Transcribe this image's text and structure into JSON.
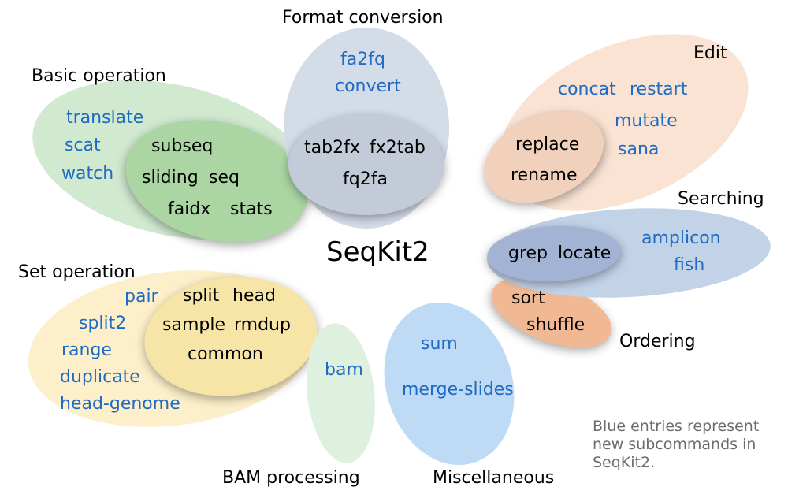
{
  "title": "SeqKit2",
  "caption": {
    "line1": "Blue entries represent",
    "line2": "new subcommands in",
    "line3": "SeqKit2."
  },
  "groups": {
    "basic": {
      "label": "Basic operation",
      "new": {
        "translate": "translate",
        "scat": "scat",
        "watch": "watch"
      },
      "old": {
        "subseq": "subseq",
        "sliding": "sliding",
        "seq": "seq",
        "faidx": "faidx",
        "stats": "stats"
      }
    },
    "set": {
      "label": "Set operation",
      "new": {
        "pair": "pair",
        "split2": "split2",
        "range": "range",
        "duplicate": "duplicate",
        "headgenome": "head-genome"
      },
      "old": {
        "split": "split",
        "head": "head",
        "sample": "sample",
        "rmdup": "rmdup",
        "common": "common"
      }
    },
    "format": {
      "label": "Format conversion",
      "new": {
        "fa2fq": "fa2fq",
        "convert": "convert"
      },
      "old": {
        "tab2fx": "tab2fx",
        "fx2tab": "fx2tab",
        "fq2fa": "fq2fa"
      }
    },
    "bam": {
      "label": "BAM processing",
      "new": {
        "bam": "bam"
      }
    },
    "misc": {
      "label": "Miscellaneous",
      "new": {
        "sum": "sum",
        "mergeslides": "merge-slides"
      }
    },
    "edit": {
      "label": "Edit",
      "new": {
        "concat": "concat",
        "restart": "restart",
        "mutate": "mutate",
        "sana": "sana"
      },
      "old": {
        "replace": "replace",
        "rename": "rename"
      }
    },
    "search": {
      "label": "Searching",
      "new": {
        "amplicon": "amplicon",
        "fish": "fish"
      },
      "old": {
        "grep": "grep",
        "locate": "locate"
      }
    },
    "order": {
      "label": "Ordering",
      "old": {
        "sort": "sort",
        "shuffle": "shuffle"
      }
    }
  }
}
